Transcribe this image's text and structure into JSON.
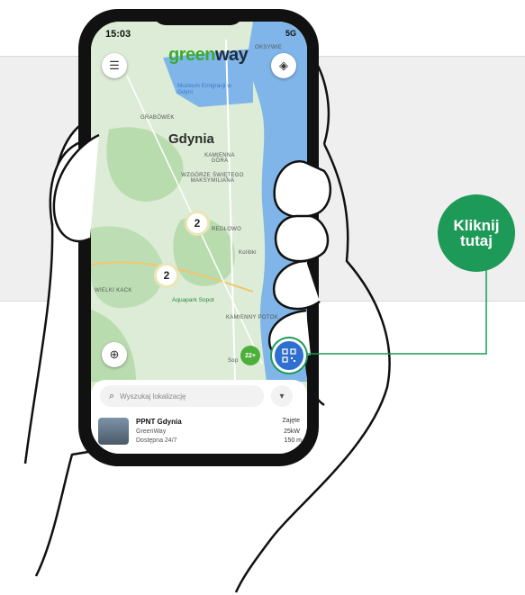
{
  "status_bar": {
    "time": "15:03",
    "network": "5G"
  },
  "map": {
    "logo_left": "green",
    "logo_right": "way",
    "city": "Gdynia",
    "labels": [
      "OKSYWIE",
      "GRABÓWEK",
      "KAMIENNA GÓRA",
      "WZGÓRZE ŚWIĘTEGO MAKSYMILIANA",
      "REDŁOWO",
      "Kolibki",
      "WIELKI KACK",
      "KAMIENNY POTOK",
      "Sop"
    ],
    "pois": [
      "Muzeum Emigracji w Gdyni",
      "Aquapark Sopot"
    ],
    "clusters": [
      "2",
      "2"
    ],
    "green_cluster": "22+"
  },
  "sheet": {
    "search_placeholder": "Wyszukaj lokalizację",
    "station": {
      "name": "PPNT Gdynia",
      "operator": "GreenWay",
      "availability": "Dostępna 24/7",
      "status": "Zajęte",
      "power": "25kW",
      "distance": "150 m"
    }
  },
  "callout": {
    "line1": "Kliknij",
    "line2": "tutaj"
  },
  "colors": {
    "accent": "#1d9a57",
    "water": "#7fb5e8",
    "land": "#d7e9d1",
    "qr_button": "#2f6fd0"
  },
  "icons": [
    "menu-icon",
    "layers-icon",
    "locate-icon",
    "search-icon",
    "filter-icon",
    "qr-scan-icon"
  ]
}
